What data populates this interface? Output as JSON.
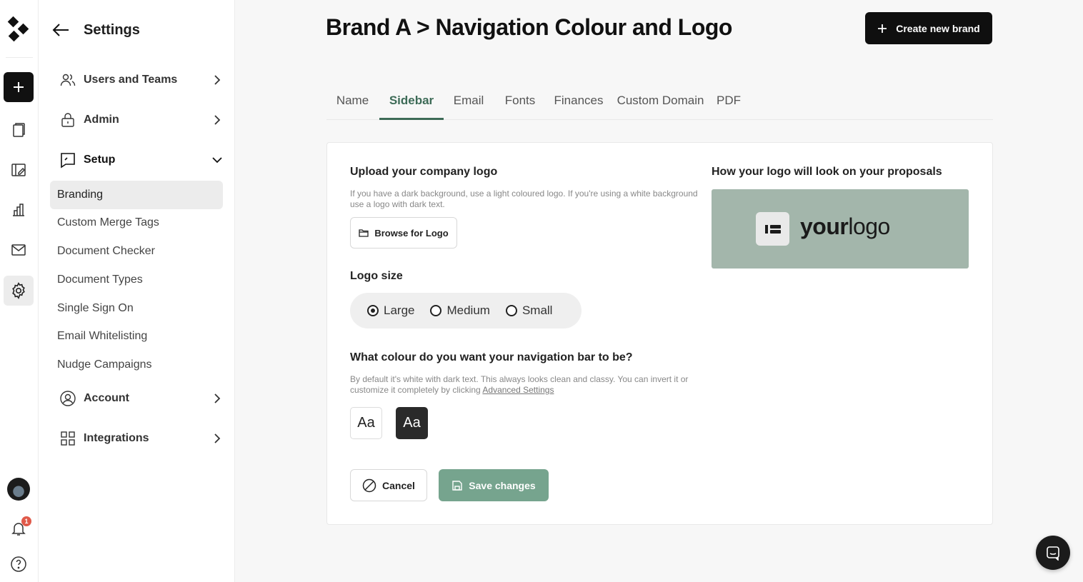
{
  "rail": {
    "notification_count": "1",
    "icons": [
      "brand-logo-icon",
      "plus-icon",
      "documents-icon",
      "templates-icon",
      "analytics-icon",
      "mail-icon",
      "gear-icon",
      "avatar",
      "bell-icon",
      "help-icon"
    ]
  },
  "settings": {
    "title": "Settings",
    "groups": {
      "users": "Users and Teams",
      "admin": "Admin",
      "setup": "Setup",
      "account": "Account",
      "integrations": "Integrations"
    },
    "setup_items": [
      "Branding",
      "Custom Merge Tags",
      "Document Checker",
      "Document Types",
      "Single Sign On",
      "Email Whitelisting",
      "Nudge Campaigns"
    ]
  },
  "header": {
    "title": "Brand A > Navigation Colour and Logo",
    "create_button": "Create new brand"
  },
  "tabs": [
    "Name",
    "Sidebar",
    "Email",
    "Fonts",
    "Finances",
    "Custom Domain",
    "PDF"
  ],
  "active_tab": "Sidebar",
  "form": {
    "upload_heading": "Upload your company logo",
    "upload_help_line1": "If you have a dark background, use a light coloured logo. If you're using a white background",
    "upload_help_line2": "use a logo with dark text.",
    "browse_button": "Browse for Logo",
    "logo_size_heading": "Logo size",
    "sizes": [
      "Large",
      "Medium",
      "Small"
    ],
    "selected_size": "Large",
    "colour_heading": "What colour do you want your navigation bar to be?",
    "colour_help_line1": "By default it's white with dark text. This always looks clean and classy. You can invert it or",
    "colour_help_line2": "customize it completely by clicking ",
    "colour_help_link": "Advanced Settings",
    "swatch_light": "Aa",
    "swatch_dark": "Aa",
    "cancel_button": "Cancel",
    "save_button": "Save changes"
  },
  "preview": {
    "heading": "How your logo will look on your proposals",
    "logo_word_bold": "your",
    "logo_word_light": "logo"
  },
  "colors": {
    "accent": "#3d6b57",
    "save_bg": "#76a48e",
    "preview_bg": "#a3b6ab",
    "primary_dark": "#0f0f0f"
  }
}
